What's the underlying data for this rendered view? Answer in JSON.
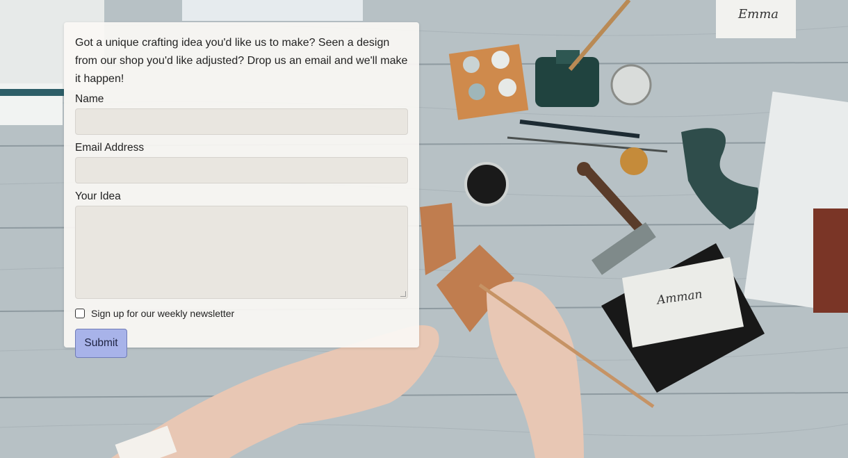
{
  "form": {
    "intro": "Got a unique crafting idea you'd like us to make? Seen a design from our shop you'd like adjusted? Drop us an email and we'll make it happen!",
    "name_label": "Name",
    "name_value": "",
    "email_label": "Email Address",
    "email_value": "",
    "idea_label": "Your Idea",
    "idea_value": "",
    "newsletter_label": "Sign up for our weekly newsletter",
    "newsletter_checked": false,
    "submit_label": "Submit"
  },
  "background": {
    "card_left": "Amman",
    "card_right": "Emma"
  },
  "colors": {
    "panel": "#faf8f4",
    "input_fill": "#e9e6e0",
    "submit_fill": "#a8b3e9",
    "submit_border": "#6f7bb7",
    "wood": "#b9c3c7"
  }
}
